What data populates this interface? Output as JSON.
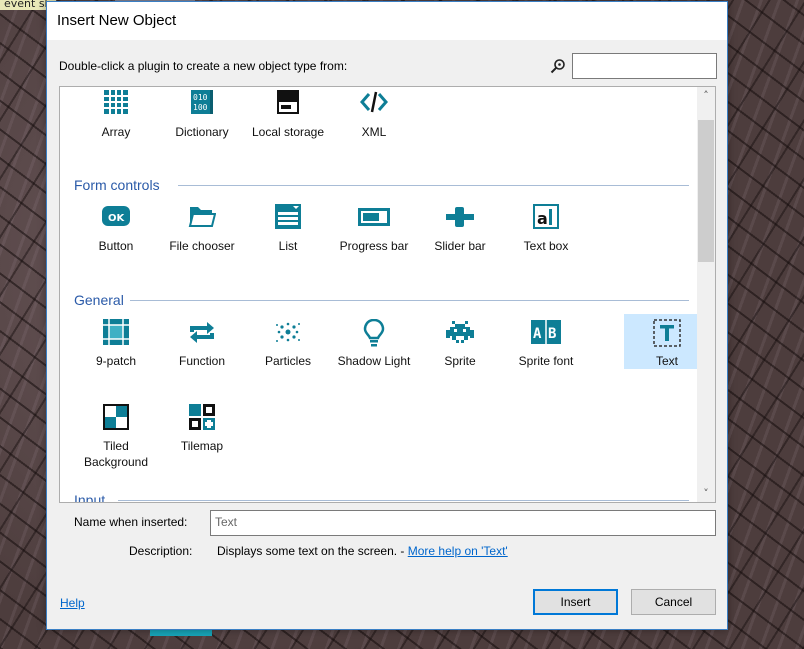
{
  "background": {
    "strip_text": "event sh"
  },
  "dialog": {
    "title": "Insert New Object",
    "prompt": "Double-click a plugin to create a new object type from:",
    "search": {
      "value": "",
      "placeholder": ""
    },
    "top_items": [
      {
        "label": "Array",
        "icon": "array-icon"
      },
      {
        "label": "Dictionary",
        "icon": "dictionary-icon"
      },
      {
        "label": "Local storage",
        "icon": "local-storage-icon"
      },
      {
        "label": "XML",
        "icon": "xml-icon"
      }
    ],
    "categories": [
      {
        "name": "Form controls",
        "items": [
          {
            "label": "Button",
            "icon": "ok-button-icon"
          },
          {
            "label": "File chooser",
            "icon": "folder-icon"
          },
          {
            "label": "List",
            "icon": "list-icon"
          },
          {
            "label": "Progress bar",
            "icon": "progress-bar-icon"
          },
          {
            "label": "Slider bar",
            "icon": "slider-icon"
          },
          {
            "label": "Text box",
            "icon": "text-box-icon"
          }
        ]
      },
      {
        "name": "General",
        "items": [
          {
            "label": "9-patch",
            "icon": "nine-patch-icon"
          },
          {
            "label": "Function",
            "icon": "refresh-arrows-icon"
          },
          {
            "label": "Particles",
            "icon": "particles-icon"
          },
          {
            "label": "Shadow Light",
            "icon": "lightbulb-icon"
          },
          {
            "label": "Sprite",
            "icon": "space-invader-icon"
          },
          {
            "label": "Sprite font",
            "icon": "sprite-font-icon"
          },
          {
            "label": "Text",
            "icon": "text-t-icon",
            "selected": true
          },
          {
            "label": "Tiled Background",
            "label_lines": [
              "Tiled",
              "Background"
            ],
            "icon": "tiled-background-icon"
          },
          {
            "label": "Tilemap",
            "icon": "tilemap-icon"
          }
        ]
      },
      {
        "name": "Input",
        "items": []
      }
    ],
    "name_label": "Name when inserted:",
    "name_value": "Text",
    "description_label": "Description:",
    "description_text": "Displays some text on the screen. - ",
    "description_link": "More help on 'Text'",
    "help_link": "Help",
    "insert_label": "Insert",
    "cancel_label": "Cancel",
    "colors": {
      "accent": "#0e7e96",
      "selection": "#cce8ff",
      "category": "#2a5aa8"
    }
  }
}
